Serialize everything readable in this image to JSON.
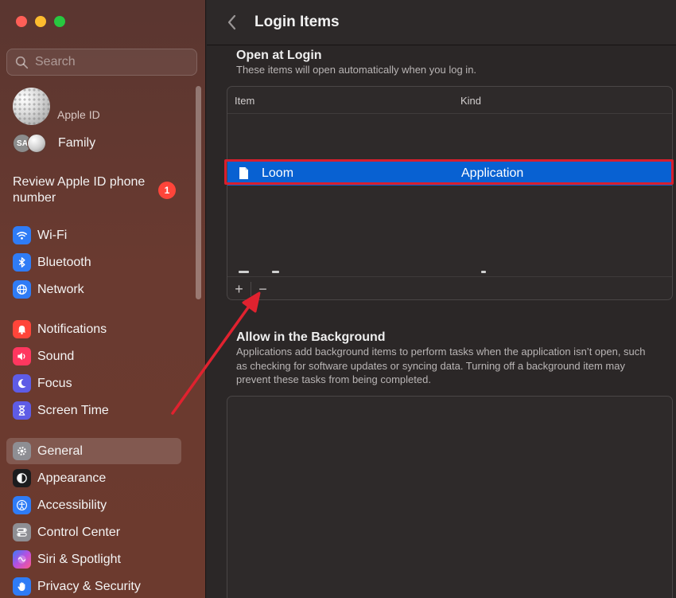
{
  "window": {
    "title": "Login Items"
  },
  "sidebar": {
    "search_placeholder": "Search",
    "apple_id_label": "Apple ID",
    "family_initials": "SA",
    "family_label": "Family",
    "review_notice": "Review Apple ID phone number",
    "review_badge": "1",
    "items": [
      {
        "label": "Wi-Fi",
        "icon": "wifi-icon",
        "color": "#2f7cf6"
      },
      {
        "label": "Bluetooth",
        "icon": "bluetooth-icon",
        "color": "#2f7cf6"
      },
      {
        "label": "Network",
        "icon": "globe-icon",
        "color": "#2f7cf6"
      },
      {
        "label": "Notifications",
        "icon": "bell-icon",
        "color": "#ff453a"
      },
      {
        "label": "Sound",
        "icon": "speaker-icon",
        "color": "#ff375f"
      },
      {
        "label": "Focus",
        "icon": "moon-icon",
        "color": "#5e5ce6"
      },
      {
        "label": "Screen Time",
        "icon": "hourglass-icon",
        "color": "#5e5ce6"
      },
      {
        "label": "General",
        "icon": "gear-icon",
        "color": "#8e8e93",
        "selected": true
      },
      {
        "label": "Appearance",
        "icon": "appearance-icon",
        "color": "#1c1c1e"
      },
      {
        "label": "Accessibility",
        "icon": "accessibility-icon",
        "color": "#2f7cf6"
      },
      {
        "label": "Control Center",
        "icon": "toggles-icon",
        "color": "#8e8e93"
      },
      {
        "label": "Siri & Spotlight",
        "icon": "siri-icon",
        "color": "#b84fe0"
      },
      {
        "label": "Privacy & Security",
        "icon": "hand-icon",
        "color": "#2f7cf6"
      }
    ]
  },
  "main": {
    "open_at_login": {
      "title": "Open at Login",
      "subtitle": "These items will open automatically when you log in.",
      "columns": [
        "Item",
        "Kind"
      ],
      "rows": [
        {
          "name": "Loom",
          "kind": "Application",
          "selected": true
        }
      ],
      "add_label": "+",
      "remove_label": "−"
    },
    "background": {
      "title": "Allow in the Background",
      "description": "Applications add background items to perform tasks when the application isn’t open, such as checking for software updates or syncing data. Turning off a background item may prevent these tasks from being completed."
    }
  },
  "annotation": {
    "highlight_color": "#d81e2d",
    "arrow_color": "#e0222f"
  }
}
